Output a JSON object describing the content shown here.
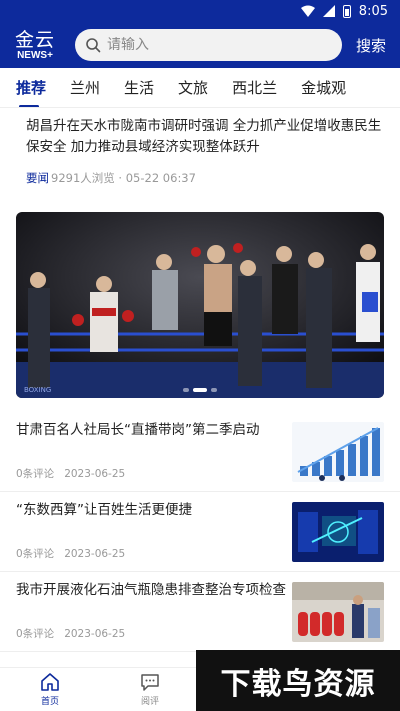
{
  "status_bar": {
    "time": "8:05"
  },
  "header": {
    "logo_main": "金云",
    "logo_sub": "NEWS+",
    "search_placeholder": "请输入",
    "search_button": "搜索"
  },
  "tabs": [
    {
      "label": "推荐",
      "active": true
    },
    {
      "label": "兰州"
    },
    {
      "label": "生活"
    },
    {
      "label": "文旅"
    },
    {
      "label": "西北兰"
    },
    {
      "label": "金城观"
    }
  ],
  "headline": {
    "title": "胡昌升在天水市陇南市调研时强调 全力抓产业促增收惠民生保安全 加力推动县域经济实现整体跃升",
    "tag": "要闻",
    "meta": "9291人浏览 · 05-22 06:37"
  },
  "banner": {
    "slides": 3,
    "active": 1
  },
  "news": [
    {
      "title": "甘肃百名人社局长“直播带岗”第二季启动",
      "comments": "0条评论",
      "date": "2023-06-25",
      "thumb": "chart"
    },
    {
      "title": "“东数西算”让百姓生活更便捷",
      "comments": "0条评论",
      "date": "2023-06-25",
      "thumb": "data"
    },
    {
      "title": "我市开展液化石油气瓶隐患排查整治专项检查",
      "comments": "0条评论",
      "date": "2023-06-25",
      "thumb": "inspection"
    }
  ],
  "bottom_nav": [
    {
      "label": "首页",
      "active": true
    },
    {
      "label": "阅评"
    }
  ],
  "watermark": "下载鸟资源",
  "colors": {
    "brand": "#0d2a9c"
  }
}
